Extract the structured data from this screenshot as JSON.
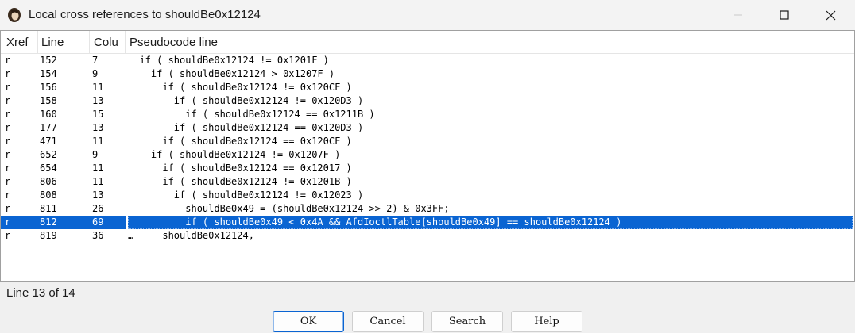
{
  "window": {
    "title": "Local cross references to shouldBe0x12124",
    "icon": "ida-portrait-icon"
  },
  "columns": {
    "xref": "Xref",
    "line": "Line",
    "column": "Colu",
    "code": "Pseudocode line"
  },
  "rows": [
    {
      "xref": "r",
      "line": "152",
      "col": "7",
      "code": "  if ( shouldBe0x12124 != 0x1201F )"
    },
    {
      "xref": "r",
      "line": "154",
      "col": "9",
      "code": "    if ( shouldBe0x12124 > 0x1207F )"
    },
    {
      "xref": "r",
      "line": "156",
      "col": "11",
      "code": "      if ( shouldBe0x12124 != 0x120CF )"
    },
    {
      "xref": "r",
      "line": "158",
      "col": "13",
      "code": "        if ( shouldBe0x12124 != 0x120D3 )"
    },
    {
      "xref": "r",
      "line": "160",
      "col": "15",
      "code": "          if ( shouldBe0x12124 == 0x1211B )"
    },
    {
      "xref": "r",
      "line": "177",
      "col": "13",
      "code": "        if ( shouldBe0x12124 == 0x120D3 )"
    },
    {
      "xref": "r",
      "line": "471",
      "col": "11",
      "code": "      if ( shouldBe0x12124 == 0x120CF )"
    },
    {
      "xref": "r",
      "line": "652",
      "col": "9",
      "code": "    if ( shouldBe0x12124 != 0x1207F )"
    },
    {
      "xref": "r",
      "line": "654",
      "col": "11",
      "code": "      if ( shouldBe0x12124 == 0x12017 )"
    },
    {
      "xref": "r",
      "line": "806",
      "col": "11",
      "code": "      if ( shouldBe0x12124 != 0x1201B )"
    },
    {
      "xref": "r",
      "line": "808",
      "col": "13",
      "code": "        if ( shouldBe0x12124 != 0x12023 )"
    },
    {
      "xref": "r",
      "line": "811",
      "col": "26",
      "code": "          shouldBe0x49 = (shouldBe0x12124 >> 2) & 0x3FF;"
    },
    {
      "xref": "r",
      "line": "812",
      "col": "69",
      "code": "          if ( shouldBe0x49 < 0x4A && AfdIoctlTable[shouldBe0x49] == shouldBe0x12124 )"
    },
    {
      "xref": "r",
      "line": "819",
      "col": "36",
      "code": "…     shouldBe0x12124,"
    }
  ],
  "selected_row_index": 12,
  "status": {
    "text": "Line 13 of 14"
  },
  "buttons": {
    "ok": "OK",
    "cancel": "Cancel",
    "search": "Search",
    "help": "Help"
  },
  "colors": {
    "selection": "#0a64d2",
    "default_button_border": "#0a64d2"
  }
}
